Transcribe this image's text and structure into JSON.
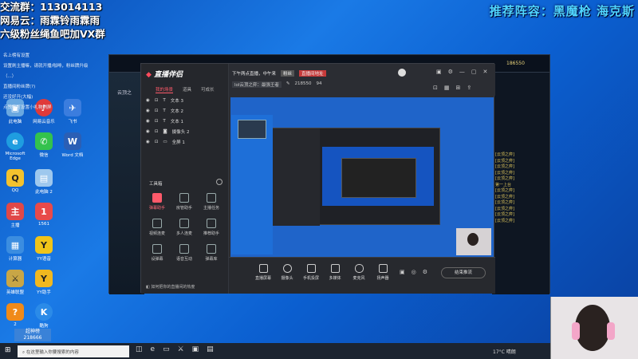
{
  "overlay": {
    "line1": "交流群：113014113",
    "line2": "网易云：雨霖铃雨霖雨",
    "line3": "六级粉丝绳鱼吧加VX群",
    "notices": [
      "名上榜有设置",
      "设置刷主播嘛，请就开播/咖啡，粉丝牌升级",
      "（...）",
      "直播间粉丝牌(?)",
      "还没好开(大幅)",
      "点赞有可设置小礼物刷屏"
    ],
    "recommend": "推荐阵容：黑魔枪 海克斯"
  },
  "desktop_icons": [
    {
      "label": "此电脑",
      "color": "#6aa8e0",
      "glyph": "▣"
    },
    {
      "label": "网易云音乐",
      "color": "#e03a3a",
      "glyph": "♪"
    },
    {
      "label": "飞书",
      "color": "#3b7dde",
      "glyph": "✈"
    },
    {
      "label": "Microsoft Edge",
      "color": "#1f9de0",
      "glyph": "e"
    },
    {
      "label": "微信",
      "color": "#33c24d",
      "glyph": "✆"
    },
    {
      "label": "Word 文档",
      "color": "#2b5fb5",
      "glyph": "W"
    },
    {
      "label": "QQ",
      "color": "#f3c22e",
      "glyph": "Q"
    },
    {
      "label": "此电脑 2",
      "color": "#9ec8ee",
      "glyph": "▤"
    },
    {
      "label": "主播",
      "color": "#e04848",
      "glyph": "主"
    },
    {
      "label": "1561",
      "color": "#e84a4a",
      "glyph": "1"
    },
    {
      "label": "计算器",
      "color": "#3b8de0",
      "glyph": "▦"
    },
    {
      "label": "YY语音",
      "color": "#f0c419",
      "glyph": "Y"
    },
    {
      "label": "英雄联盟",
      "color": "#c8a646",
      "glyph": "⚔"
    },
    {
      "label": "YY助手",
      "color": "#f0b820",
      "glyph": "Y"
    },
    {
      "label": "2",
      "color": "#f08a1a",
      "glyph": "?"
    },
    {
      "label": "酷狗",
      "color": "#2b8be8",
      "glyph": "K"
    }
  ],
  "app": {
    "logo": "直播伴侣",
    "tabs": [
      "我的场景",
      "道具",
      "可成长"
    ],
    "scenes": [
      "文本 3",
      "文本 2",
      "文本 1",
      "摄像头 2",
      "全屏 1"
    ],
    "tools_title": "工具箱",
    "tools": [
      "弹幕助手",
      "房管助手",
      "主播任务",
      "视频连麦",
      "多人连麦",
      "推荐助手",
      "设弹幕",
      "语音互动",
      "弹幕库"
    ],
    "notice": "如何把你的直播间的热度",
    "header": {
      "time_label": "下午两点直播，中午来",
      "badge1": "粉丝",
      "badge2": "直播间地址",
      "title": "lol云顶之弈：最强王者",
      "viewers": "218550",
      "likes": "94"
    },
    "bottom_buttons": [
      "直播屏幕",
      "摄像头",
      "手机投屏",
      "多媒体",
      "麦克风",
      "扬声器"
    ],
    "end_button": "结束推流"
  },
  "game": {
    "top_number": "186550",
    "left_label": "云顶之",
    "chat": [
      "[云顶之弈]",
      "[云顶之弈]",
      "[云顶之弈]",
      "[云顶之弈]",
      "[云顶之弈]",
      "第一上台",
      "[云顶之弈]",
      "[云顶之弈]",
      "[云顶之弈]",
      "[云顶之弈]",
      "[云顶之弈]",
      "[云顶之弈]"
    ]
  },
  "taskbar": {
    "search_placeholder": "在这里输入你要搜索的内容",
    "weather": "17°C 晴朗",
    "time": "??:??"
  },
  "bottom_badge": {
    "label": "超神榜",
    "count": "218666"
  }
}
